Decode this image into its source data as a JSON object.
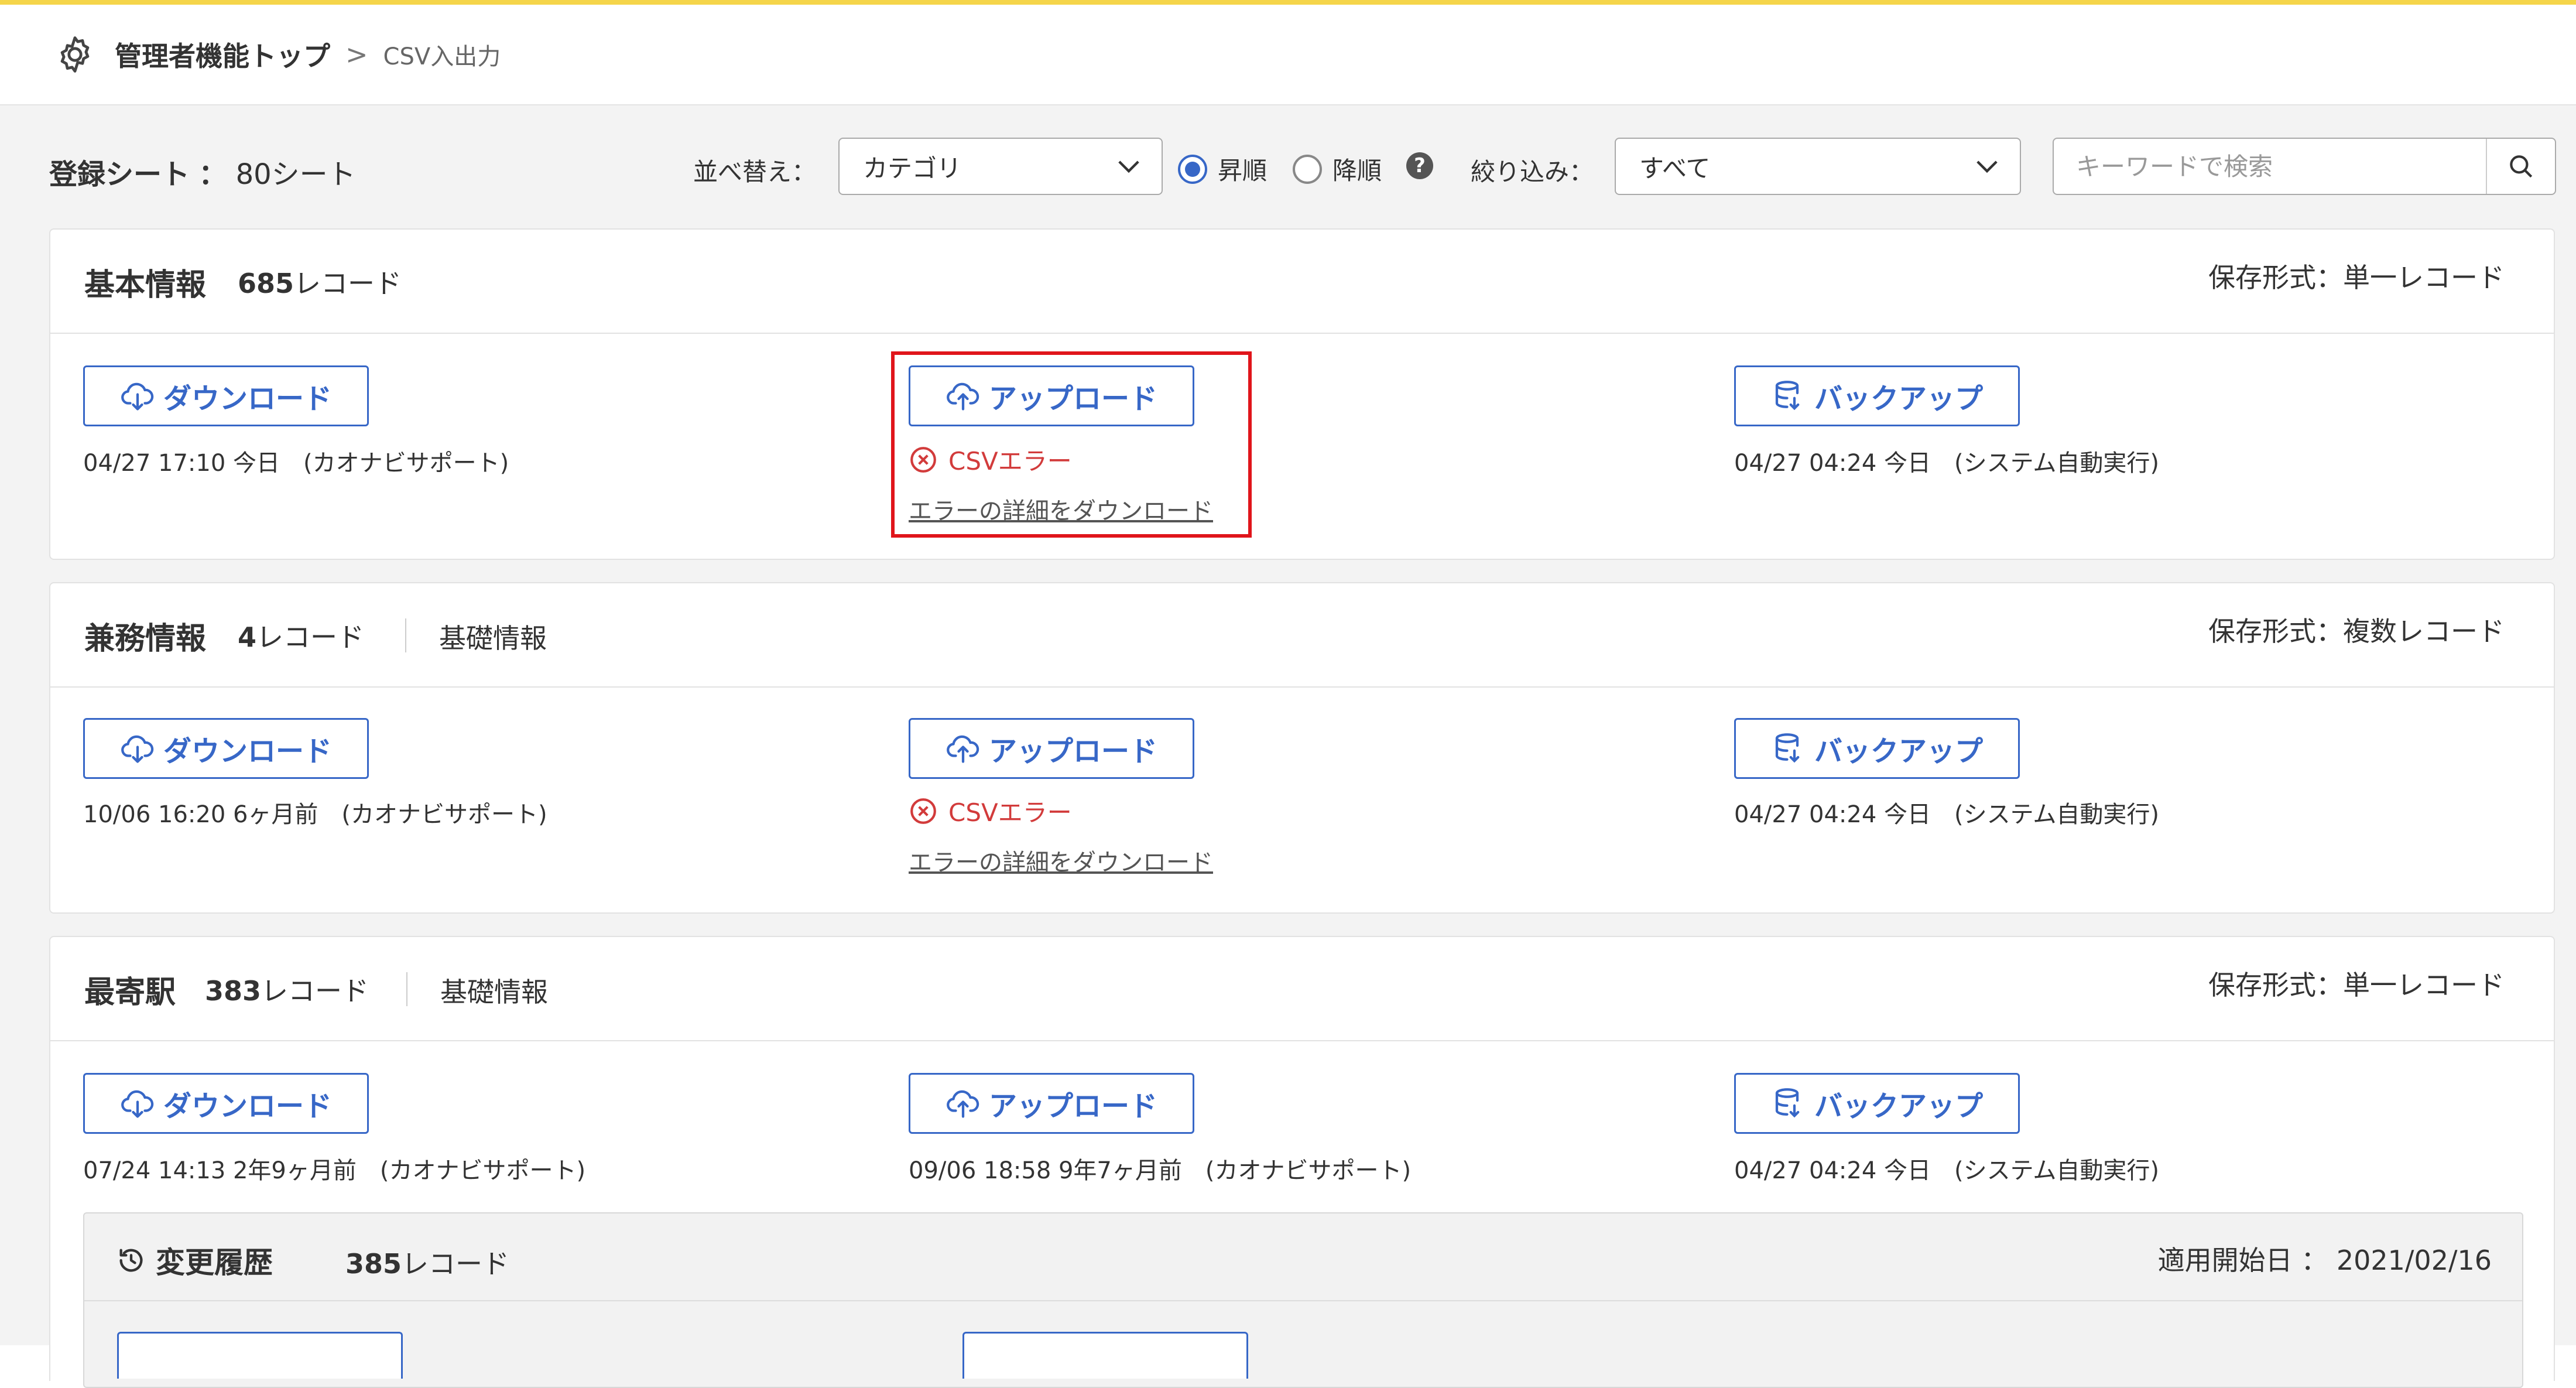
{
  "breadcrumb": {
    "home": "管理者機能トップ",
    "separator": ">",
    "current": "CSV入出力"
  },
  "toolbar": {
    "sheet_label": "登録シート",
    "sheet_colon": "：",
    "sheet_count": "80シート",
    "sort_label": "並べ替え：",
    "sort_value": "カテゴリ",
    "order_asc": "昇順",
    "order_desc": "降順",
    "order_selected": "asc",
    "help": "?",
    "filter_label": "絞り込み：",
    "filter_value": "すべて",
    "search_placeholder": "キーワードで検索"
  },
  "actions": {
    "download": "ダウンロード",
    "upload": "アップロード",
    "backup": "バックアップ"
  },
  "cards": [
    {
      "title": "基本情報",
      "count_num": "685",
      "count_unit": "レコード",
      "category": "",
      "format": "保存形式：単一レコード",
      "download_meta": "04/27 17:10 今日　(カオナビサポート)",
      "upload_error": "CSVエラー",
      "upload_error_link": "エラーの詳細をダウンロード",
      "backup_meta": "04/27 04:24 今日　(システム自動実行)"
    },
    {
      "title": "兼務情報",
      "count_num": "4",
      "count_unit": "レコード",
      "category": "基礎情報",
      "format": "保存形式：複数レコード",
      "download_meta": "10/06 16:20 6ヶ月前　(カオナビサポート)",
      "upload_error": "CSVエラー",
      "upload_error_link": "エラーの詳細をダウンロード",
      "backup_meta": "04/27 04:24 今日　(システム自動実行)"
    },
    {
      "title": "最寄駅",
      "count_num": "383",
      "count_unit": "レコード",
      "category": "基礎情報",
      "format": "保存形式：単一レコード",
      "download_meta": "07/24 14:13 2年9ヶ月前　(カオナビサポート)",
      "upload_meta": "09/06 18:58 9年7ヶ月前　(カオナビサポート)",
      "backup_meta": "04/27 04:24 今日　(システム自動実行)"
    }
  ],
  "history": {
    "title": "変更履歴",
    "count_num": "385",
    "count_unit": "レコード",
    "start_date": "適用開始日 ： 2021/02/16"
  },
  "colors": {
    "accent": "#3767c7",
    "error": "#d23b3b",
    "highlight": "#e0151b",
    "top_bar": "#f5d54a"
  }
}
